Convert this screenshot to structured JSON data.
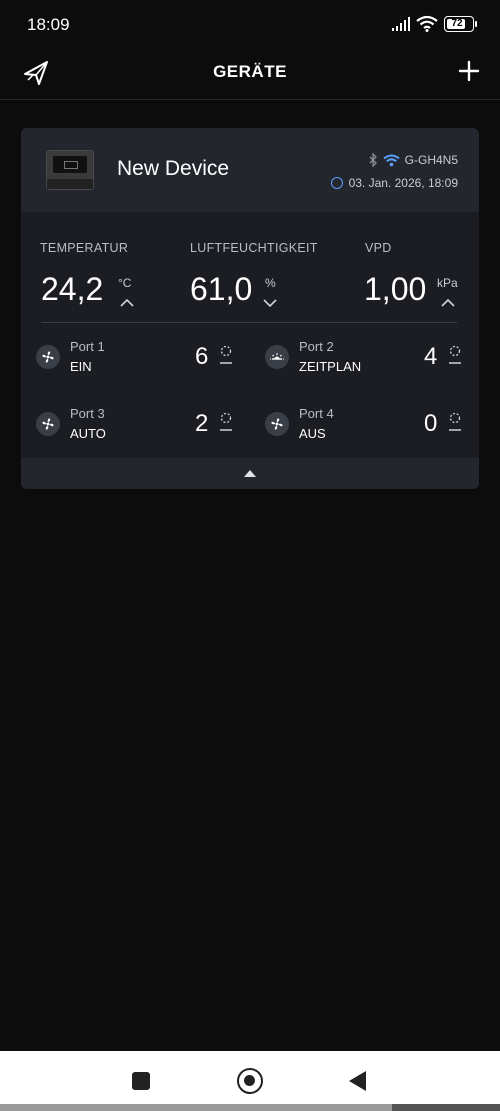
{
  "status_bar": {
    "time": "18:09",
    "battery": "72"
  },
  "header": {
    "title": "GERÄTE"
  },
  "device": {
    "name": "New Device",
    "id": "G-GH4N5",
    "timestamp": "03. Jan. 2026, 18:09"
  },
  "metrics": [
    {
      "label": "TEMPERATUR",
      "value": "24,2",
      "unit": "°C",
      "trend": "up"
    },
    {
      "label": "LUFTFEUCHTIGKEIT",
      "value": "61,0",
      "unit": "%",
      "trend": "down"
    },
    {
      "label": "VPD",
      "value": "1,00",
      "unit": "kPa",
      "trend": "up"
    }
  ],
  "ports": [
    {
      "name": "Port 1",
      "mode": "EIN",
      "level": "6",
      "icon": "fan-icon"
    },
    {
      "name": "Port 2",
      "mode": "ZEITPLAN",
      "level": "4",
      "icon": "light-icon"
    },
    {
      "name": "Port 3",
      "mode": "AUTO",
      "level": "2",
      "icon": "fan-icon"
    },
    {
      "name": "Port 4",
      "mode": "AUS",
      "level": "0",
      "icon": "fan-icon"
    }
  ],
  "colors": {
    "background": "#0c0c0c",
    "card": "#1b1d22",
    "card_header": "#23262d",
    "accent_blue": "#5aa0ff"
  }
}
